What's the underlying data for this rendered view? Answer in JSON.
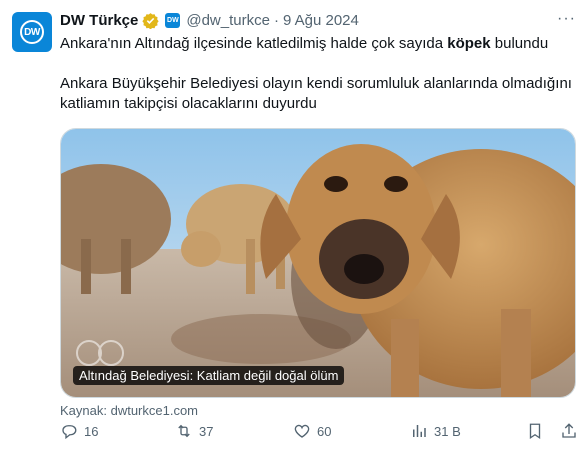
{
  "author": {
    "name": "DW Türkçe",
    "handle": "@dw_turkce",
    "date": "9 Ağu 2024",
    "avatar_text": "DW",
    "affiliation_badge_text": "DW"
  },
  "tweet": {
    "line1_pre": "Ankara'nın Altındağ ilçesinde katledilmiş halde çok sayıda ",
    "line1_bold": "köpek",
    "line1_post": " bulundu",
    "paragraph2": "Ankara Büyükşehir Belediyesi olayın kendi sorumluluk alanlarında olmadığını katliamın takipçisi olacaklarını duyurdu"
  },
  "card": {
    "caption": "Altındağ Belediyesi: Katliam değil doğal ölüm",
    "source": "Kaynak: dwturkce1.com",
    "watermark_text": "DW"
  },
  "metrics": {
    "replies": "16",
    "retweets": "37",
    "likes": "60",
    "views": "31 B"
  },
  "colors": {
    "brand": "#0a86d8",
    "verified_gold": "#e2b719",
    "secondary_text": "#536471"
  }
}
